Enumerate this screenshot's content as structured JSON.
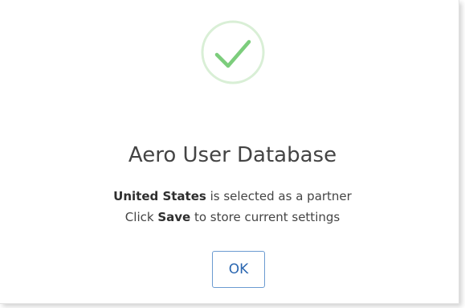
{
  "dialog": {
    "icon": "success-check-icon",
    "title": "Aero User Database",
    "message_line1": {
      "bold": "United States",
      "rest": " is selected as a partner"
    },
    "message_line2": {
      "prefix": "Click ",
      "bold": "Save",
      "suffix": " to store current settings"
    },
    "ok_label": "OK"
  },
  "colors": {
    "check_stroke": "#7ccd7c",
    "check_ring": "#d9efd6",
    "button_border": "#6b9bd1",
    "button_text": "#2a66b0",
    "text": "#444444"
  }
}
